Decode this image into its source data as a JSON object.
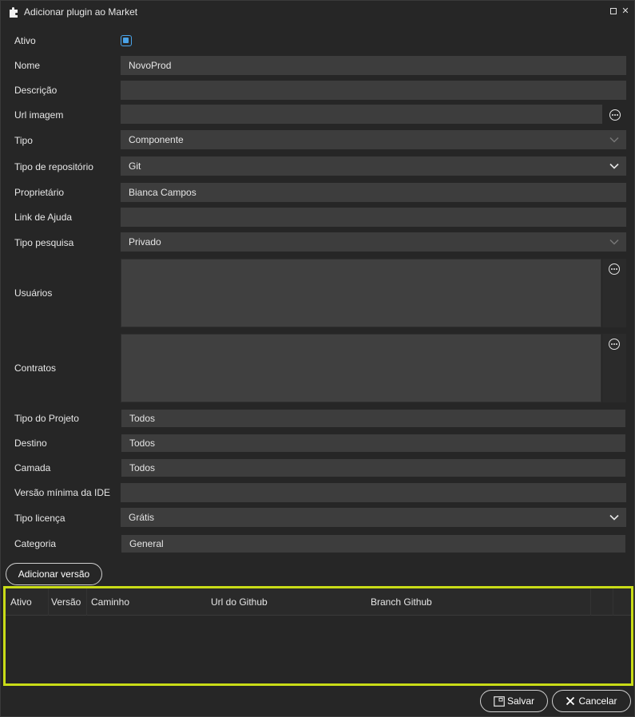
{
  "window": {
    "title": "Adicionar plugin ao Market"
  },
  "form": {
    "ativo_label": "Ativo",
    "nome_label": "Nome",
    "nome_value": "NovoProd",
    "descricao_label": "Descrição",
    "descricao_value": "",
    "url_imagem_label": "Url imagem",
    "url_imagem_value": "",
    "tipo_label": "Tipo",
    "tipo_value": "Componente",
    "tipo_repositorio_label": "Tipo de repositório",
    "tipo_repositorio_value": "Git",
    "proprietario_label": "Proprietário",
    "proprietario_value": "Bianca Campos",
    "link_ajuda_label": "Link de Ajuda",
    "link_ajuda_value": "",
    "tipo_pesquisa_label": "Tipo pesquisa",
    "tipo_pesquisa_value": "Privado",
    "usuarios_label": "Usuários",
    "contratos_label": "Contratos",
    "tipo_projeto_label": "Tipo do Projeto",
    "tipo_projeto_value": "Todos",
    "destino_label": "Destino",
    "destino_value": "Todos",
    "camada_label": "Camada",
    "camada_value": "Todos",
    "versao_minima_label": "Versão mínima da IDE",
    "versao_minima_value": "",
    "tipo_licenca_label": "Tipo licença",
    "tipo_licenca_value": "Grátis",
    "categoria_label": "Categoria",
    "categoria_value": "General"
  },
  "versions": {
    "add_button": "Adicionar versão",
    "columns": [
      "Ativo",
      "Versão",
      "Caminho",
      "Url do Github",
      "Branch Github"
    ]
  },
  "footer": {
    "save_label": "Salvar",
    "cancel_label": "Cancelar"
  },
  "colors": {
    "background": "#262626",
    "field": "#3d3d3d",
    "accent_checkbox": "#4aa3e8",
    "highlight_border": "#c9dc17"
  }
}
